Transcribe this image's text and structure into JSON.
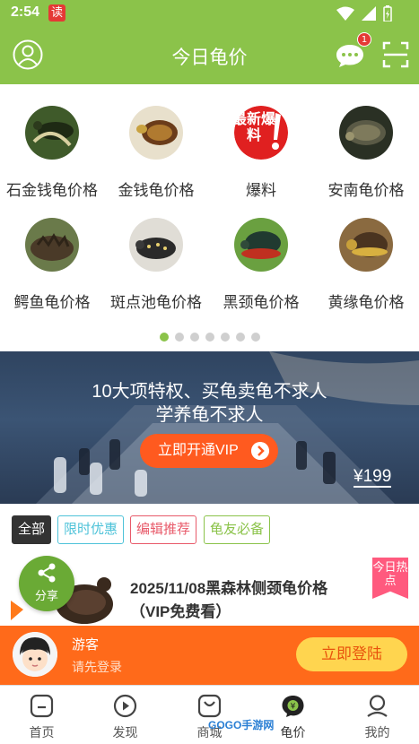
{
  "status_bar": {
    "time": "2:54",
    "app_badge": "读"
  },
  "header": {
    "title": "今日龟价",
    "message_count": "1"
  },
  "categories": [
    {
      "label": "石金钱龟价格",
      "icon": "turtle-photo"
    },
    {
      "label": "金钱龟价格",
      "icon": "turtle-photo"
    },
    {
      "label": "爆料",
      "icon": "breaking-news-icon",
      "icon_text": "最新爆料"
    },
    {
      "label": "安南龟价格",
      "icon": "turtle-photo"
    },
    {
      "label": "鳄鱼龟价格",
      "icon": "turtle-photo"
    },
    {
      "label": "斑点池龟价格",
      "icon": "turtle-photo"
    },
    {
      "label": "黑颈龟价格",
      "icon": "turtle-photo"
    },
    {
      "label": "黄缘龟价格",
      "icon": "turtle-photo"
    }
  ],
  "pager": {
    "count": 7,
    "active_index": 0
  },
  "banner": {
    "line1": "10大项特权、买龟卖龟不求人",
    "line2": "学养龟不求人",
    "button_label": "立即开通VIP",
    "price": "¥199"
  },
  "filters": [
    {
      "label": "全部",
      "color": "#333333",
      "selected": true
    },
    {
      "label": "限时优惠",
      "color": "#4fc3d9",
      "selected": false
    },
    {
      "label": "编辑推荐",
      "color": "#e85a6a",
      "selected": false
    },
    {
      "label": "龟友必备",
      "color": "#8bc34a",
      "selected": false
    }
  ],
  "article": {
    "title": "2025/11/08黑森林侧颈龟价格（VIP免费看）",
    "hot_tag": "今日热点"
  },
  "share": {
    "label": "分享"
  },
  "login_bar": {
    "name": "游客",
    "hint": "请先登录",
    "button_label": "立即登陆"
  },
  "nav": [
    {
      "label": "首页",
      "icon": "home-icon"
    },
    {
      "label": "发现",
      "icon": "play-icon"
    },
    {
      "label": "商城",
      "icon": "shop-bag-icon"
    },
    {
      "label": "龟价",
      "icon": "turtle-price-icon"
    },
    {
      "label": "我的",
      "icon": "profile-icon"
    }
  ],
  "watermark": "GOGO手游网",
  "colors": {
    "brand_green": "#8bc34a",
    "accent_orange": "#ff6a1a",
    "badge_red": "#e53935"
  }
}
